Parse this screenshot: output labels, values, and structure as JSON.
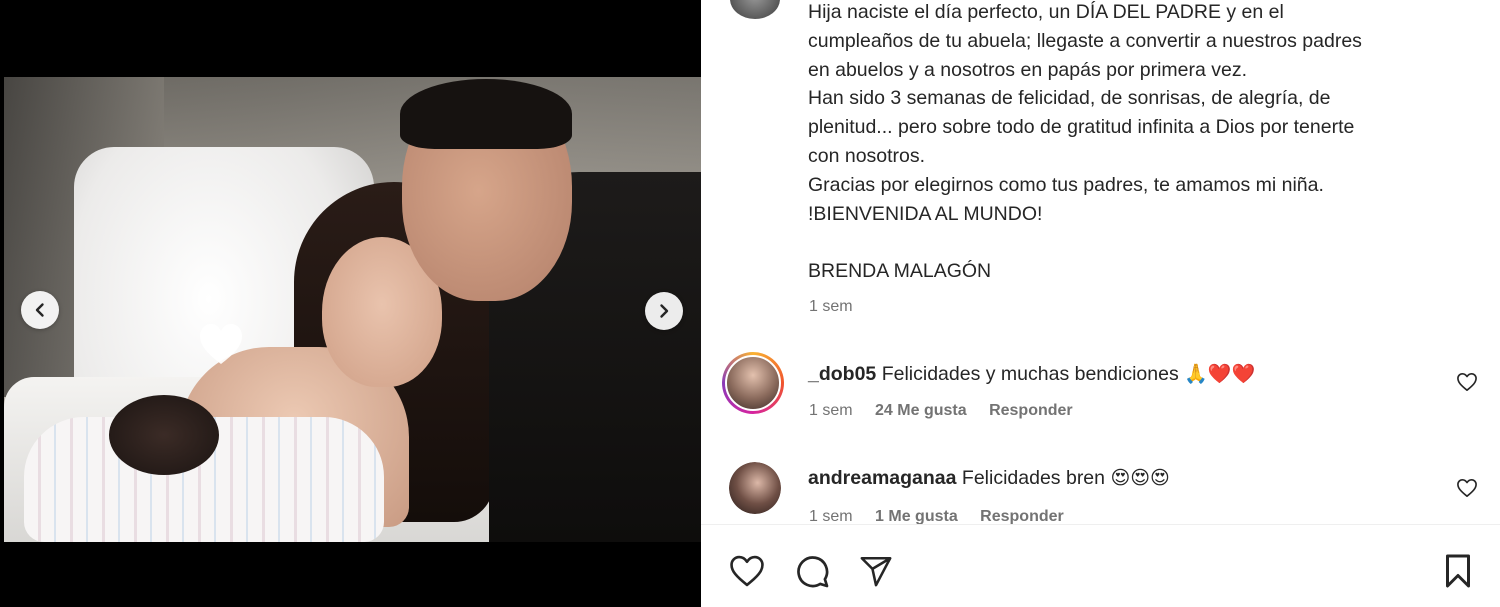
{
  "post": {
    "caption_lines": [
      "Hija naciste el día perfecto, un DÍA DEL PADRE y en el",
      "cumpleaños de tu abuela; llegaste a convertir a nuestros padres",
      "en abuelos y a nosotros en papás por primera vez.",
      "Han sido 3 semanas de felicidad, de sonrisas, de alegría, de",
      "plenitud... pero sobre todo de gratitud infinita a Dios por tenerte",
      "con nosotros.",
      "Gracias por elegirnos como tus padres, te amamos mi niña.",
      "!BIENVENIDA AL MUNDO!",
      "",
      "BRENDA MALAGÓN"
    ],
    "time": "1 sem"
  },
  "comments": [
    {
      "username": "_dob05",
      "text": "Felicidades y muchas bendiciones",
      "emojis": "🙏❤️❤️",
      "time": "1 sem",
      "likes": "24 Me gusta",
      "reply": "Responder"
    },
    {
      "username": "andreamaganaa",
      "text": "Felicidades bren",
      "emojis": "😍😍😍",
      "time": "1 sem",
      "likes": "1 Me gusta",
      "reply": "Responder"
    }
  ],
  "icons": {
    "like": "heart-icon",
    "comment": "comment-icon",
    "share": "send-icon",
    "save": "bookmark-icon",
    "prev": "chevron-left-icon",
    "next": "chevron-right-icon"
  },
  "colors": {
    "text": "#262626",
    "secondary": "#737373",
    "divider": "#efefef"
  }
}
